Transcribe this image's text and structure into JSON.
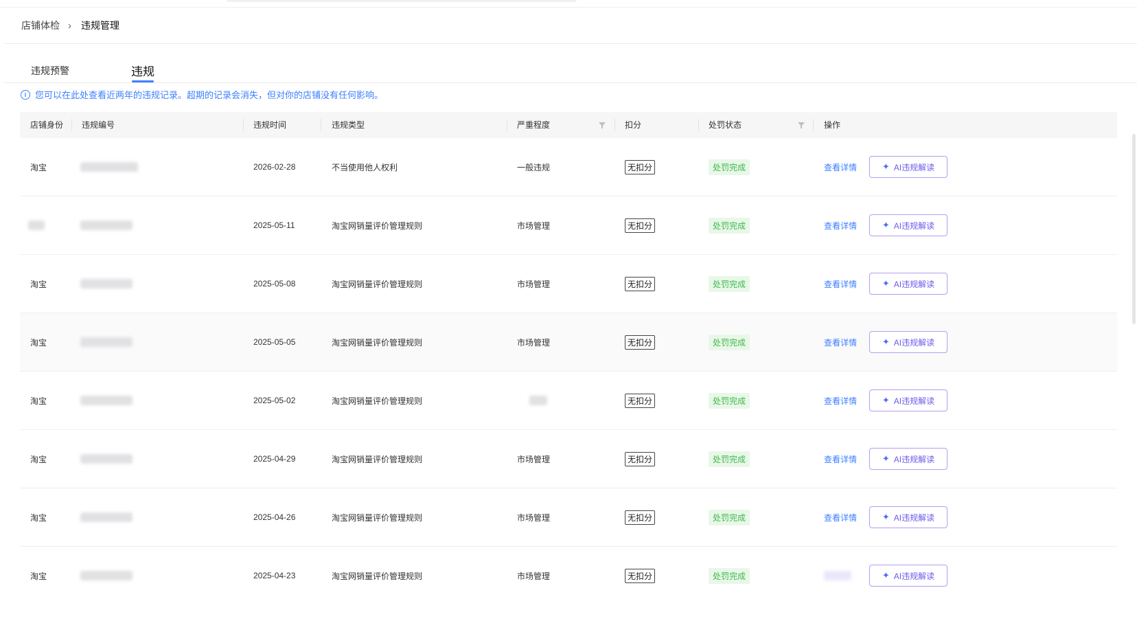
{
  "breadcrumb": {
    "root": "店铺体检",
    "current": "违规管理"
  },
  "tabs": [
    {
      "label": "违规预警"
    },
    {
      "label": "违规"
    }
  ],
  "notice": "您可以在此处查看近两年的违规记录。超期的记录会消失，但对你的店铺没有任何影响。",
  "table": {
    "headers": {
      "shop": "店铺身份",
      "id": "违规编号",
      "time": "违规时间",
      "type": "违规类型",
      "severity": "严重程度",
      "score": "扣分",
      "status": "处罚状态",
      "action": "操作"
    },
    "rows": [
      {
        "shop": "淘宝",
        "time": "2026-02-28",
        "type": "不当使用他人权利",
        "severity": "一般违规",
        "score": "无扣分",
        "status": "处罚完成",
        "detail": "查看详情",
        "ai": "AI违规解读"
      },
      {
        "shop": "",
        "time": "2025-05-11",
        "type": "淘宝网销量评价管理规则",
        "severity": "市场管理",
        "score": "无扣分",
        "status": "处罚完成",
        "detail": "查看详情",
        "ai": "AI违规解读"
      },
      {
        "shop": "淘宝",
        "time": "2025-05-08",
        "type": "淘宝网销量评价管理规则",
        "severity": "市场管理",
        "score": "无扣分",
        "status": "处罚完成",
        "detail": "查看详情",
        "ai": "AI违规解读"
      },
      {
        "shop": "淘宝",
        "time": "2025-05-05",
        "type": "淘宝网销量评价管理规则",
        "severity": "市场管理",
        "score": "无扣分",
        "status": "处罚完成",
        "detail": "查看详情",
        "ai": "AI违规解读"
      },
      {
        "shop": "淘宝",
        "time": "2025-05-02",
        "type": "淘宝网销量评价管理规则",
        "severity": "",
        "score": "无扣分",
        "status": "处罚完成",
        "detail": "查看详情",
        "ai": "AI违规解读"
      },
      {
        "shop": "淘宝",
        "time": "2025-04-29",
        "type": "淘宝网销量评价管理规则",
        "severity": "市场管理",
        "score": "无扣分",
        "status": "处罚完成",
        "detail": "查看详情",
        "ai": "AI违规解读"
      },
      {
        "shop": "淘宝",
        "time": "2025-04-26",
        "type": "淘宝网销量评价管理规则",
        "severity": "市场管理",
        "score": "无扣分",
        "status": "处罚完成",
        "detail": "查看详情",
        "ai": "AI违规解读"
      },
      {
        "shop": "淘宝",
        "time": "2025-04-23",
        "type": "淘宝网销量评价管理规则",
        "severity": "市场管理",
        "score": "无扣分",
        "status": "处罚完成",
        "detail": "",
        "ai": "AI违规解读"
      }
    ]
  },
  "colors": {
    "accent": "#3d7fff",
    "success": "#3dba4a",
    "ai_border": "#b69cf2"
  }
}
